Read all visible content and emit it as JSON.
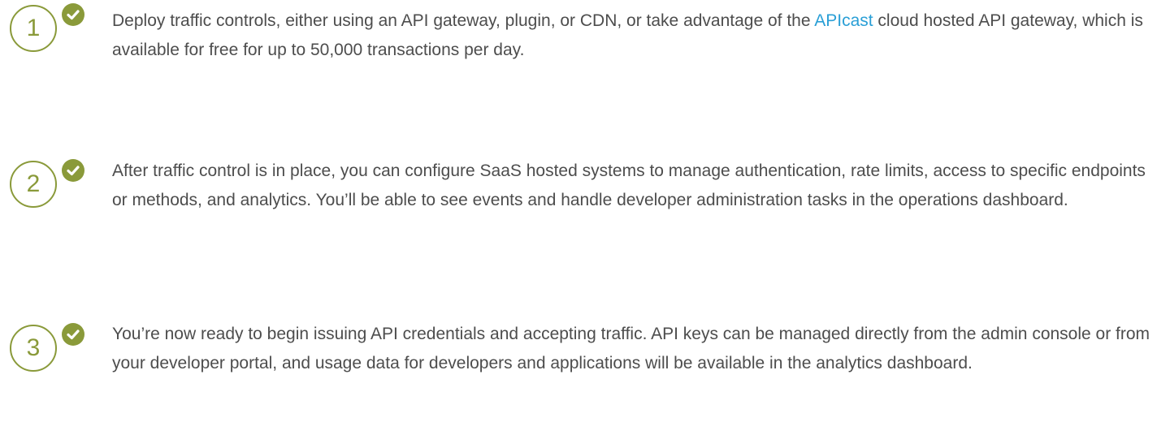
{
  "colors": {
    "accent_green": "#8a9a3a",
    "text": "#4d4d4d",
    "link": "#2a9fd6"
  },
  "icons": {
    "check": "check-icon"
  },
  "steps": [
    {
      "number": "1",
      "text_before": "Deploy traffic controls, either using an API gateway, plugin, or CDN, or take advantage of the ",
      "link_text": "APIcast",
      "text_after": " cloud hosted API gateway, which is available for free for up to 50,000 transactions per day."
    },
    {
      "number": "2",
      "text": "After traffic control is in place, you can configure SaaS hosted systems to manage authentication, rate limits, access to specific endpoints or methods, and analytics. You’ll be able to see events and handle developer administration tasks in the operations dashboard."
    },
    {
      "number": "3",
      "text": "You’re now ready to begin issuing API credentials and accepting traffic. API keys can be managed directly from the admin console or from your developer portal, and usage data for developers and applications will be available in the analytics dashboard."
    }
  ]
}
